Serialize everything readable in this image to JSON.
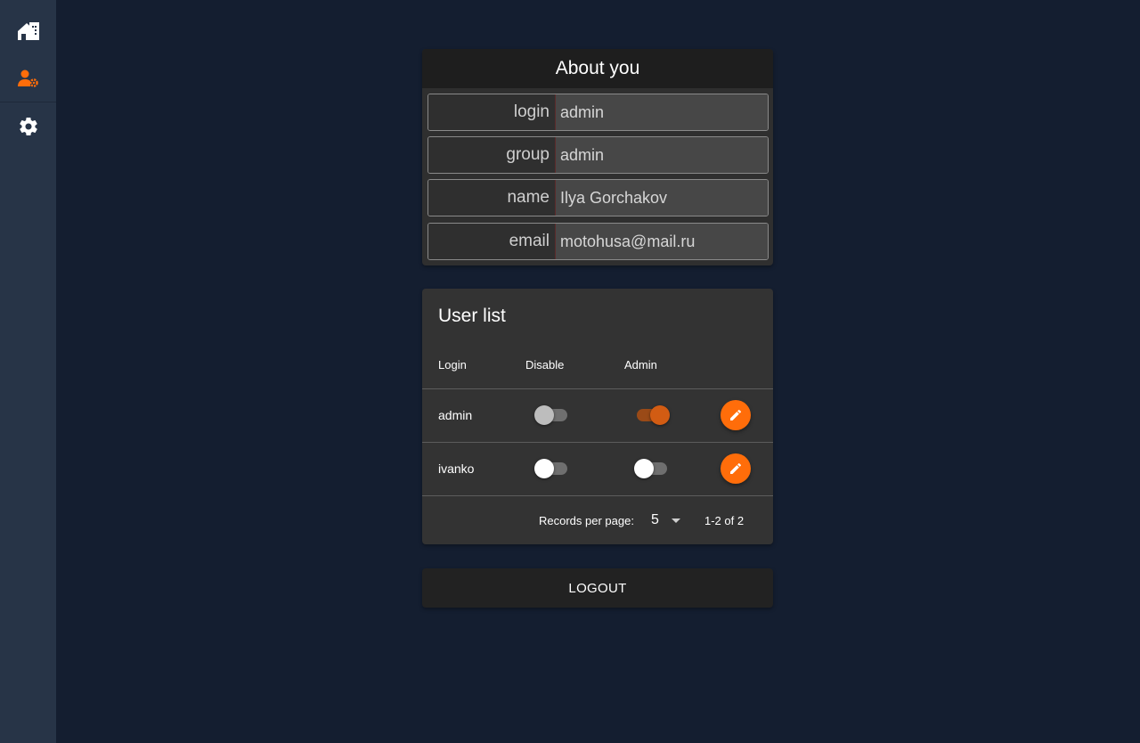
{
  "sidebar": {
    "items": [
      {
        "icon": "home-icon",
        "active": false
      },
      {
        "icon": "user-settings-icon",
        "active": true
      },
      {
        "icon": "gear-icon",
        "active": false
      }
    ],
    "accent": "#ff6d0a"
  },
  "about": {
    "title": "About you",
    "fields": [
      {
        "label": "login",
        "value": "admin"
      },
      {
        "label": "group",
        "value": "admin"
      },
      {
        "label": "name",
        "value": "Ilya Gorchakov"
      },
      {
        "label": "email",
        "value": "motohusa@mail.ru"
      }
    ]
  },
  "user_list": {
    "title": "User list",
    "columns": [
      "Login",
      "Disable",
      "Admin"
    ],
    "rows": [
      {
        "login": "admin",
        "disable": false,
        "disable_locked": true,
        "admin": true
      },
      {
        "login": "ivanko",
        "disable": false,
        "disable_locked": false,
        "admin": false
      }
    ],
    "footer": {
      "records_per_page_label": "Records per page:",
      "records_per_page": "5",
      "range": "1-2 of 2"
    }
  },
  "logout_label": "LOGOUT"
}
